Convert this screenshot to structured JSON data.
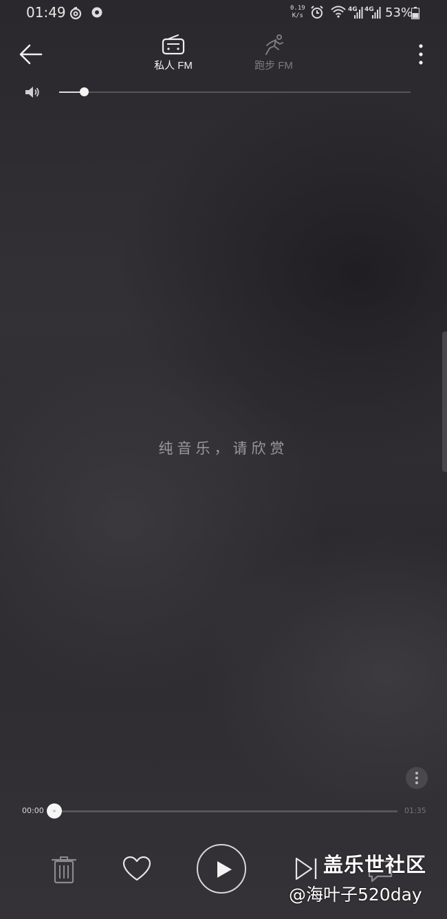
{
  "status_bar": {
    "time": "01:49",
    "net_speed_value": "0.19",
    "net_speed_unit": "K/s",
    "network_type_1": "4G",
    "network_type_2": "4G",
    "battery": "53%"
  },
  "header": {
    "tabs": [
      {
        "label": "私人 FM",
        "icon": "radio-icon",
        "active": true
      },
      {
        "label": "跑步 FM",
        "icon": "running-icon",
        "active": false
      }
    ]
  },
  "volume": {
    "level": 0.07
  },
  "lyrics": {
    "text": "纯音乐，请欣赏"
  },
  "player": {
    "current_time": "00:00",
    "total_time": "01:35",
    "progress": 0.0
  },
  "watermark": {
    "title": "盖乐世社区",
    "subtitle": "@海叶子520day"
  },
  "colors": {
    "background": "#2f2d31",
    "accent_white": "#f4f4f4",
    "track": "#58565a",
    "muted_text": "#7e7c80"
  }
}
